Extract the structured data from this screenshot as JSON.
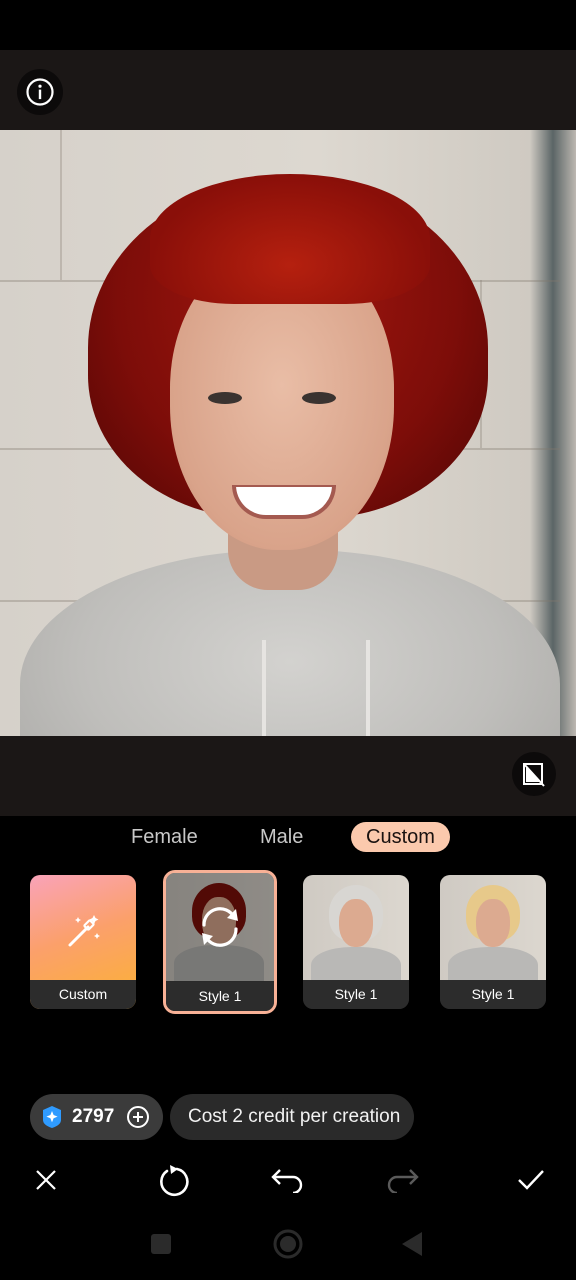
{
  "icons": {
    "info": "info-icon",
    "compare": "compare-icon",
    "magic_wand": "magic-wand-icon",
    "regenerate": "refresh-icon",
    "gem": "gem-icon",
    "add_credits": "plus-circle-icon",
    "close": "close-icon",
    "redo_generate": "rotate-icon",
    "undo": "undo-icon",
    "redo": "redo-icon",
    "confirm": "check-icon",
    "nav_recent": "square-icon",
    "nav_home": "circle-icon",
    "nav_back": "triangle-back-icon"
  },
  "tabs": [
    {
      "label": "Female"
    },
    {
      "label": "Male"
    },
    {
      "label": "Custom",
      "active": true
    }
  ],
  "styles": [
    {
      "label": "Custom"
    },
    {
      "label": "Style 1",
      "selected": true,
      "hair_color": "#7f100a"
    },
    {
      "label": "Style 1",
      "hair_color": "#d8d6d2"
    },
    {
      "label": "Style 1",
      "hair_color": "#e7c98a"
    }
  ],
  "credits": {
    "count": "2797"
  },
  "cost_tip": "Cost 2 credit per creation",
  "colors": {
    "accent": "#fbc9ad",
    "selected_border": "#f8b196",
    "gem": "#2f9bff"
  }
}
